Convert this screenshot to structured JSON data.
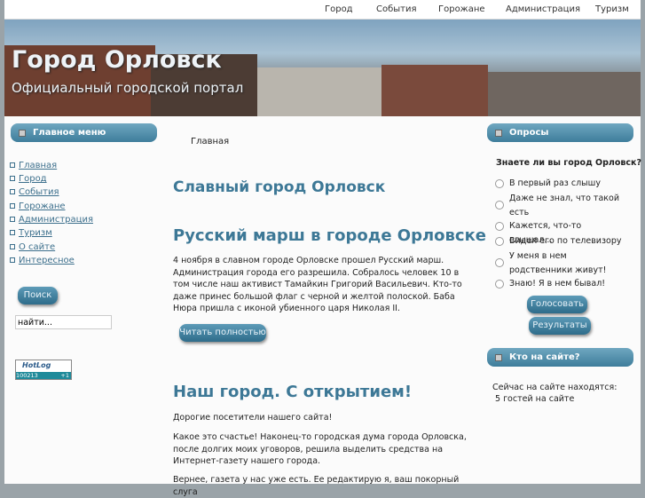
{
  "topnav": [
    "Город",
    "События",
    "Горожане",
    "Администрация",
    "Туризм"
  ],
  "header": {
    "title": "Город Орловск",
    "subtitle": "Официальный городской портал"
  },
  "left": {
    "menu_title": "Главное меню",
    "menu": [
      "Главная",
      "Город",
      "События",
      "Горожане",
      "Администрация",
      "Туризм",
      "О сайте",
      "Интересное"
    ],
    "search_button": "Поиск",
    "search_value": "найти...",
    "counter": {
      "logo": "HotLog",
      "value": "100213",
      "delta": "+1"
    }
  },
  "main": {
    "breadcrumb": "Главная",
    "page_title": "Славный город Орловск",
    "articles": [
      {
        "title": "Русский марш в городе Орловске",
        "paragraphs": [
          "4 ноября в славном городе Орловске прошел Русский марш. Администрация города его разрешила. Собралось человек  10  в том числе наш активист Тамайкин Григорий Васильевич. Кто-то даже принес большой флаг с черной и желтой полоской. Баба Нюра пришла с иконой убиенного царя Николая II."
        ],
        "read_more": "Читать полностью"
      },
      {
        "title": "Наш город. С открытием!",
        "paragraphs": [
          "Дорогие посетители нашего сайта!",
          "Какое это счастье! Наконец-то городская дума города Орловска, после долгих моих уговоров, решила выделить средства на Интернет-газету нашего города.",
          "Вернее, газета у нас уже есть. Ее редактирую я, ваш покорный слуга"
        ]
      }
    ]
  },
  "right": {
    "poll_title": "Опросы",
    "question": "Знаете ли вы город Орловск?",
    "options": [
      "В первый раз слышу",
      "Даже не знал, что такой есть",
      "Кажется, что-то слышал...",
      "Видел его по телевизору",
      "У меня в нем родственники живут!",
      "Знаю! Я в нем бывал!"
    ],
    "vote": "Голосовать",
    "results": "Результаты",
    "who_title": "Кто на сайте?",
    "who_line1": "Сейчас на сайте находятся:",
    "who_line2": "5 гостей на сайте"
  }
}
